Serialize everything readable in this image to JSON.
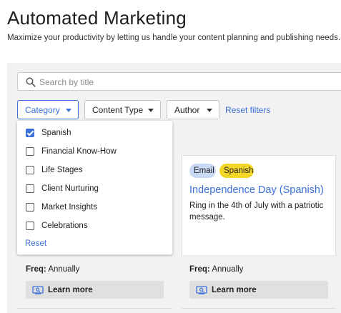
{
  "header": {
    "title": "Automated Marketing",
    "subtitle": "Maximize your productivity by letting us handle your content planning and publishing needs."
  },
  "search": {
    "placeholder": "Search by title",
    "value": ""
  },
  "filters": {
    "category_label": "Category",
    "content_type_label": "Content Type",
    "author_label": "Author",
    "reset_label": "Reset filters"
  },
  "category_dropdown": {
    "options": [
      {
        "label": "Spanish",
        "checked": true
      },
      {
        "label": "Financial Know-How",
        "checked": false
      },
      {
        "label": "Life Stages",
        "checked": false
      },
      {
        "label": "Client Nurturing",
        "checked": false
      },
      {
        "label": "Market Insights",
        "checked": false
      },
      {
        "label": "Celebrations",
        "checked": false
      }
    ],
    "reset_label": "Reset"
  },
  "cards": [
    {
      "freq_label": "Freq:",
      "freq_value": "Annually",
      "learn_label": "Learn more"
    },
    {
      "badges": [
        "Email",
        "Spanish"
      ],
      "title": "Independence Day (Spanish)",
      "description": "Ring in the 4th of July with a patriotic message.",
      "freq_label": "Freq:",
      "freq_value": "Annually",
      "learn_label": "Learn more"
    }
  ],
  "colors": {
    "accent": "#3a6fd8",
    "email_badge": "#c9d9f5",
    "spanish_badge": "#f4d626",
    "content_bg": "#f2f2f2"
  }
}
